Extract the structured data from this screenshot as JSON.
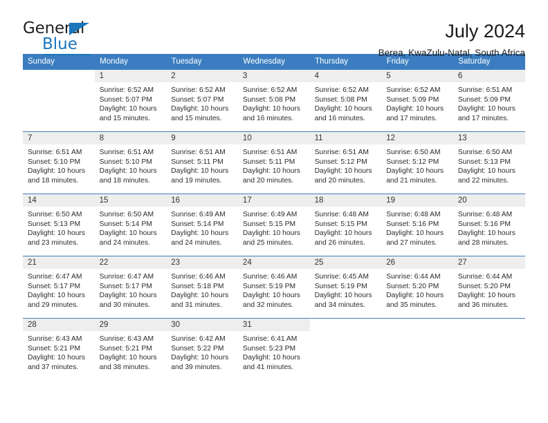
{
  "brand": {
    "word_one": "General",
    "word_two": "Blue",
    "accent_color": "#1b75bb",
    "triangle_icon": "triangle-icon"
  },
  "header": {
    "title": "July 2024",
    "subtitle": "Berea, KwaZulu-Natal, South Africa"
  },
  "calendar": {
    "header_background": "#3b7dc0",
    "daynum_background": "#eeeeee",
    "weekday_headers": [
      "Sunday",
      "Monday",
      "Tuesday",
      "Wednesday",
      "Thursday",
      "Friday",
      "Saturday"
    ],
    "weeks": [
      [
        {
          "day": "",
          "sunrise": "",
          "sunset": "",
          "daylight": "",
          "blank": true
        },
        {
          "day": "1",
          "sunrise": "Sunrise: 6:52 AM",
          "sunset": "Sunset: 5:07 PM",
          "daylight": "Daylight: 10 hours and 15 minutes."
        },
        {
          "day": "2",
          "sunrise": "Sunrise: 6:52 AM",
          "sunset": "Sunset: 5:07 PM",
          "daylight": "Daylight: 10 hours and 15 minutes."
        },
        {
          "day": "3",
          "sunrise": "Sunrise: 6:52 AM",
          "sunset": "Sunset: 5:08 PM",
          "daylight": "Daylight: 10 hours and 16 minutes."
        },
        {
          "day": "4",
          "sunrise": "Sunrise: 6:52 AM",
          "sunset": "Sunset: 5:08 PM",
          "daylight": "Daylight: 10 hours and 16 minutes."
        },
        {
          "day": "5",
          "sunrise": "Sunrise: 6:52 AM",
          "sunset": "Sunset: 5:09 PM",
          "daylight": "Daylight: 10 hours and 17 minutes."
        },
        {
          "day": "6",
          "sunrise": "Sunrise: 6:51 AM",
          "sunset": "Sunset: 5:09 PM",
          "daylight": "Daylight: 10 hours and 17 minutes."
        }
      ],
      [
        {
          "day": "7",
          "sunrise": "Sunrise: 6:51 AM",
          "sunset": "Sunset: 5:10 PM",
          "daylight": "Daylight: 10 hours and 18 minutes."
        },
        {
          "day": "8",
          "sunrise": "Sunrise: 6:51 AM",
          "sunset": "Sunset: 5:10 PM",
          "daylight": "Daylight: 10 hours and 18 minutes."
        },
        {
          "day": "9",
          "sunrise": "Sunrise: 6:51 AM",
          "sunset": "Sunset: 5:11 PM",
          "daylight": "Daylight: 10 hours and 19 minutes."
        },
        {
          "day": "10",
          "sunrise": "Sunrise: 6:51 AM",
          "sunset": "Sunset: 5:11 PM",
          "daylight": "Daylight: 10 hours and 20 minutes."
        },
        {
          "day": "11",
          "sunrise": "Sunrise: 6:51 AM",
          "sunset": "Sunset: 5:12 PM",
          "daylight": "Daylight: 10 hours and 20 minutes."
        },
        {
          "day": "12",
          "sunrise": "Sunrise: 6:50 AM",
          "sunset": "Sunset: 5:12 PM",
          "daylight": "Daylight: 10 hours and 21 minutes."
        },
        {
          "day": "13",
          "sunrise": "Sunrise: 6:50 AM",
          "sunset": "Sunset: 5:13 PM",
          "daylight": "Daylight: 10 hours and 22 minutes."
        }
      ],
      [
        {
          "day": "14",
          "sunrise": "Sunrise: 6:50 AM",
          "sunset": "Sunset: 5:13 PM",
          "daylight": "Daylight: 10 hours and 23 minutes."
        },
        {
          "day": "15",
          "sunrise": "Sunrise: 6:50 AM",
          "sunset": "Sunset: 5:14 PM",
          "daylight": "Daylight: 10 hours and 24 minutes."
        },
        {
          "day": "16",
          "sunrise": "Sunrise: 6:49 AM",
          "sunset": "Sunset: 5:14 PM",
          "daylight": "Daylight: 10 hours and 24 minutes."
        },
        {
          "day": "17",
          "sunrise": "Sunrise: 6:49 AM",
          "sunset": "Sunset: 5:15 PM",
          "daylight": "Daylight: 10 hours and 25 minutes."
        },
        {
          "day": "18",
          "sunrise": "Sunrise: 6:48 AM",
          "sunset": "Sunset: 5:15 PM",
          "daylight": "Daylight: 10 hours and 26 minutes."
        },
        {
          "day": "19",
          "sunrise": "Sunrise: 6:48 AM",
          "sunset": "Sunset: 5:16 PM",
          "daylight": "Daylight: 10 hours and 27 minutes."
        },
        {
          "day": "20",
          "sunrise": "Sunrise: 6:48 AM",
          "sunset": "Sunset: 5:16 PM",
          "daylight": "Daylight: 10 hours and 28 minutes."
        }
      ],
      [
        {
          "day": "21",
          "sunrise": "Sunrise: 6:47 AM",
          "sunset": "Sunset: 5:17 PM",
          "daylight": "Daylight: 10 hours and 29 minutes."
        },
        {
          "day": "22",
          "sunrise": "Sunrise: 6:47 AM",
          "sunset": "Sunset: 5:17 PM",
          "daylight": "Daylight: 10 hours and 30 minutes."
        },
        {
          "day": "23",
          "sunrise": "Sunrise: 6:46 AM",
          "sunset": "Sunset: 5:18 PM",
          "daylight": "Daylight: 10 hours and 31 minutes."
        },
        {
          "day": "24",
          "sunrise": "Sunrise: 6:46 AM",
          "sunset": "Sunset: 5:19 PM",
          "daylight": "Daylight: 10 hours and 32 minutes."
        },
        {
          "day": "25",
          "sunrise": "Sunrise: 6:45 AM",
          "sunset": "Sunset: 5:19 PM",
          "daylight": "Daylight: 10 hours and 34 minutes."
        },
        {
          "day": "26",
          "sunrise": "Sunrise: 6:44 AM",
          "sunset": "Sunset: 5:20 PM",
          "daylight": "Daylight: 10 hours and 35 minutes."
        },
        {
          "day": "27",
          "sunrise": "Sunrise: 6:44 AM",
          "sunset": "Sunset: 5:20 PM",
          "daylight": "Daylight: 10 hours and 36 minutes."
        }
      ],
      [
        {
          "day": "28",
          "sunrise": "Sunrise: 6:43 AM",
          "sunset": "Sunset: 5:21 PM",
          "daylight": "Daylight: 10 hours and 37 minutes."
        },
        {
          "day": "29",
          "sunrise": "Sunrise: 6:43 AM",
          "sunset": "Sunset: 5:21 PM",
          "daylight": "Daylight: 10 hours and 38 minutes."
        },
        {
          "day": "30",
          "sunrise": "Sunrise: 6:42 AM",
          "sunset": "Sunset: 5:22 PM",
          "daylight": "Daylight: 10 hours and 39 minutes."
        },
        {
          "day": "31",
          "sunrise": "Sunrise: 6:41 AM",
          "sunset": "Sunset: 5:23 PM",
          "daylight": "Daylight: 10 hours and 41 minutes."
        },
        {
          "day": "",
          "sunrise": "",
          "sunset": "",
          "daylight": "",
          "blank": true
        },
        {
          "day": "",
          "sunrise": "",
          "sunset": "",
          "daylight": "",
          "blank": true
        },
        {
          "day": "",
          "sunrise": "",
          "sunset": "",
          "daylight": "",
          "blank": true
        }
      ]
    ]
  }
}
